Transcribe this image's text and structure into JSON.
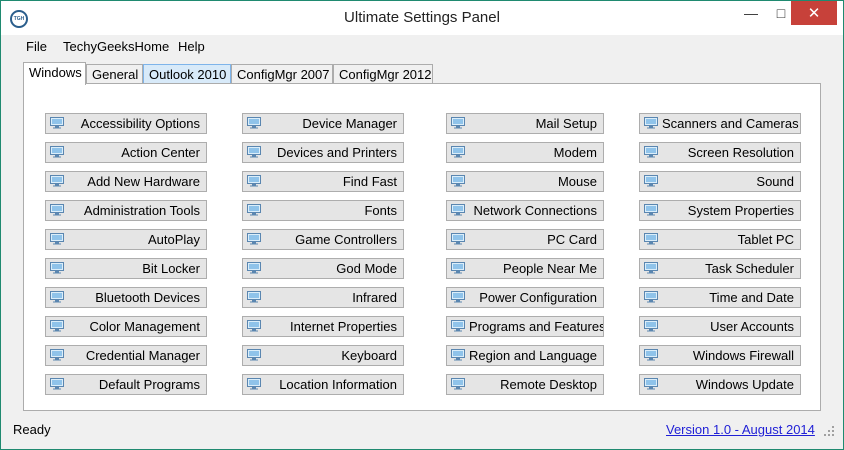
{
  "window": {
    "title": "Ultimate Settings Panel",
    "icon_text": "TGH"
  },
  "menu": [
    "File",
    "TechyGeeksHome",
    "Help"
  ],
  "tabs": [
    "Windows",
    "General",
    "Outlook 2010",
    "ConfigMgr 2007",
    "ConfigMgr 2012"
  ],
  "columns": [
    [
      "Accessibility Options",
      "Action Center",
      "Add New Hardware",
      "Administration Tools",
      "AutoPlay",
      "Bit Locker",
      "Bluetooth Devices",
      "Color Management",
      "Credential Manager",
      "Default Programs"
    ],
    [
      "Device Manager",
      "Devices and Printers",
      "Find Fast",
      "Fonts",
      "Game Controllers",
      "God Mode",
      "Infrared",
      "Internet Properties",
      "Keyboard",
      "Location Information"
    ],
    [
      "Mail Setup",
      "Modem",
      "Mouse",
      "Network Connections",
      "PC Card",
      "People Near Me",
      "Power Configuration",
      "Programs and Features",
      "Region and Language",
      "Remote Desktop"
    ],
    [
      "Scanners and Cameras",
      "Screen Resolution",
      "Sound",
      "System Properties",
      "Tablet PC",
      "Task Scheduler",
      "Time and Date",
      "User Accounts",
      "Windows Firewall",
      "Windows Update"
    ]
  ],
  "status": {
    "text": "Ready",
    "version": "Version 1.0 - August 2014"
  },
  "colors": {
    "accent_border": "#1f8a70",
    "close_button": "#c7413a",
    "link": "#1f1fd6"
  }
}
